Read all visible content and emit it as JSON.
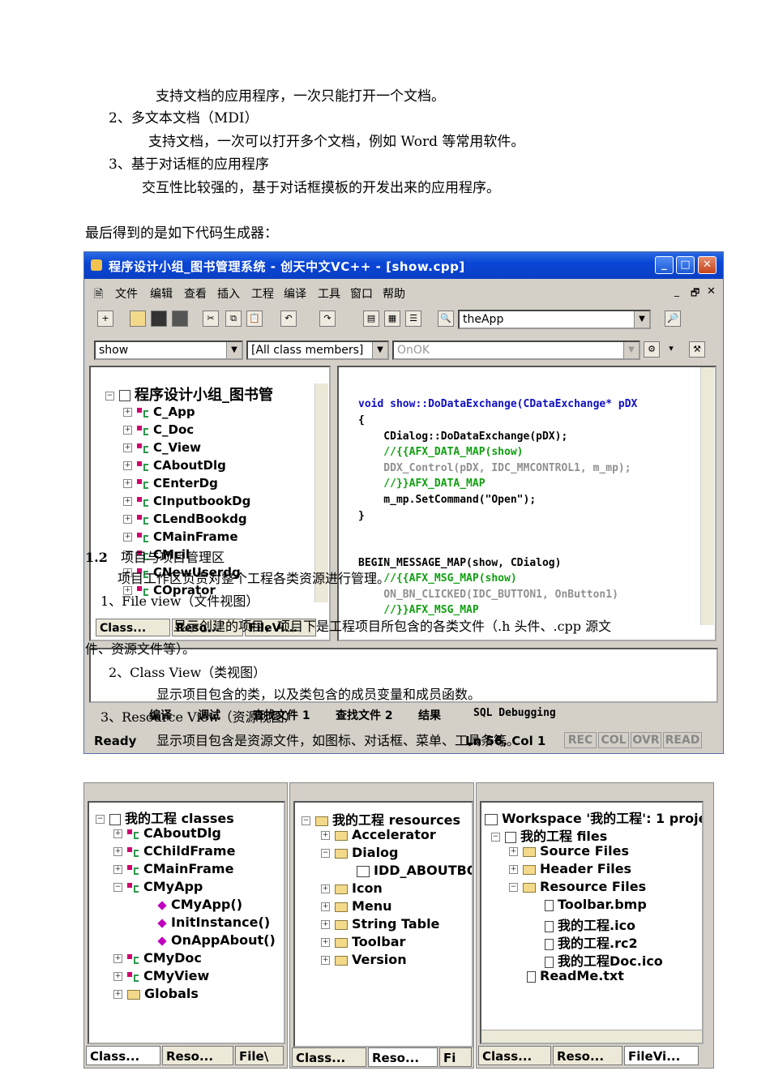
{
  "doc": {
    "line1": "支持文档的应用程序，一次只能打开一个文档。",
    "line2": "2、多文本文档（MDI）",
    "line3": "支持文档，一次可以打开多个文档，例如 Word 等常用软件。",
    "line4": "3、基于对话框的应用程序",
    "line5": "交互性比较强的，基于对话框摸板的开发出来的应用程序。",
    "line6": "最后得到的是如下代码生成器："
  },
  "ide": {
    "title": "程序设计小组_图书管理系统 - 创天中文VC++ - [show.cpp]",
    "menu": [
      "文件",
      "编辑",
      "查看",
      "插入",
      "工程",
      "编译",
      "工具",
      "窗口",
      "帮助"
    ],
    "find_combo": "theApp",
    "class_combo": "show",
    "filter_combo": "[All class members]",
    "member_combo": "OnOK",
    "tree_root": "程序设计小组_图书管",
    "classes": [
      "C_App",
      "C_Doc",
      "C_View",
      "CAboutDlg",
      "CEnterDg",
      "CInputbookDg",
      "CLendBookdg",
      "CMainFrame",
      "CMcil",
      "CNewUserdg",
      "COprator"
    ],
    "code": [
      "void show::DoDataExchange(CDataExchange* pDX",
      "{",
      "    CDialog::DoDataExchange(pDX);",
      "    //{{AFX_DATA_MAP(show)",
      "    DDX_Control(pDX, IDC_MMCONTROL1, m_mp);",
      "    //}}AFX_DATA_MAP",
      "    m_mp.SetCommand(\"Open\");",
      "}",
      "",
      "BEGIN_MESSAGE_MAP(show, CDialog)",
      "    //{{AFX_MSG_MAP(show)",
      "    ON_BN_CLICKED(IDC_BUTTON1, OnButton1)",
      "    //}}AFX_MSG_MAP"
    ],
    "left_tabs": [
      "Class...",
      "Reso...",
      "FileVi..."
    ],
    "output_tabs": [
      "编译",
      "调试",
      "查找文件 1",
      "查找文件 2",
      "结果",
      "SQL Debugging"
    ],
    "status": {
      "ready": "Ready",
      "position": "Ln 56, Col 1",
      "indicators": [
        "REC",
        "COL",
        "OVR",
        "READ"
      ]
    },
    "overlay": {
      "h12_num": "1.2",
      "h12_text": "项目与项目管理区",
      "p1": "项目工作区负责对整个工程各类资源进行管理。",
      "fv_title": "1、File view（文件视图）",
      "fv_desc_a": "显示创建的项目，项目下是工程项目所包含的各类文件（.h 头件、.cpp 源文",
      "fv_desc_b": "件、资源文件等）。",
      "cv_title": "2、Class View（类视图）",
      "cv_desc": "显示项目包含的类，以及类包含的成员变量和成员函数。",
      "rv_title": "3、Resource View（资源视图）",
      "rv_desc": "显示项目包含是资源文件，如图标、对话框、菜单、工具条等。"
    }
  },
  "panels": {
    "class_view": {
      "root": "我的工程 classes",
      "items": [
        "CAboutDlg",
        "CChildFrame",
        "CMainFrame",
        "CMyApp",
        "CMyApp()",
        "InitInstance()",
        "OnAppAbout()",
        "CMyDoc",
        "CMyView",
        "Globals"
      ],
      "tabs": [
        "Class...",
        "Reso...",
        "File\\"
      ]
    },
    "resource_view": {
      "root": "我的工程 resources",
      "items": [
        "Accelerator",
        "Dialog",
        "IDD_ABOUTBOX",
        "Icon",
        "Menu",
        "String Table",
        "Toolbar",
        "Version"
      ],
      "tabs": [
        "Class...",
        "Reso...",
        "Fi"
      ]
    },
    "file_view": {
      "workspace": "Workspace '我的工程': 1 proje",
      "root": "我的工程 files",
      "items": [
        "Source Files",
        "Header Files",
        "Resource Files",
        "Toolbar.bmp",
        "我的工程.ico",
        "我的工程.rc2",
        "我的工程Doc.ico",
        "ReadMe.txt"
      ],
      "tabs": [
        "Class...",
        "Reso...",
        "FileVi..."
      ]
    }
  }
}
